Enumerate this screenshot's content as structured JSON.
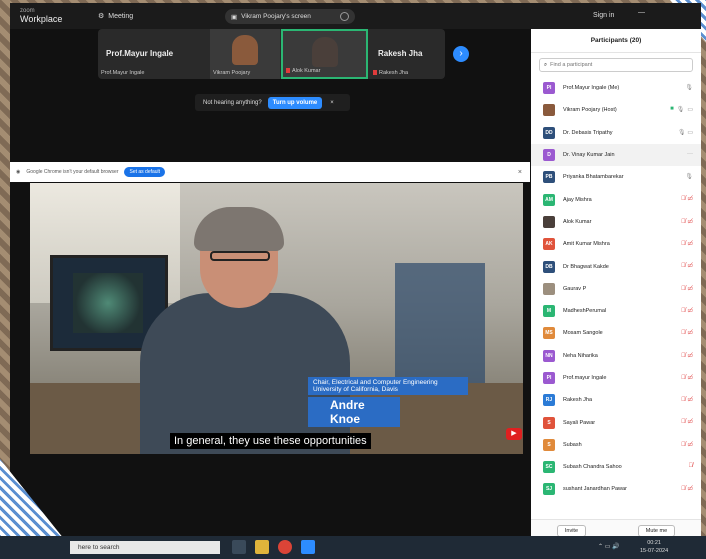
{
  "topbar": {
    "brand_small": "zoom",
    "brand_big": "Workplace",
    "meeting_label": "Meeting",
    "screen_share_label": "Vikram Poojary's screen",
    "signin_label": "Sign in"
  },
  "strip": {
    "tiles": [
      {
        "big": "Prof.Mayur Ingale",
        "small": "Prof.Mayur Ingale"
      },
      {
        "small": "Vikram Poojary"
      },
      {
        "small": "Alok Kumar"
      },
      {
        "big": "Rakesh Jha",
        "small": "Rakesh Jha"
      }
    ]
  },
  "audio_banner": {
    "text": "Not hearing anything?",
    "button": "Turn up volume",
    "close": "×"
  },
  "chrome_bar": {
    "message": "Google Chrome isn't your default browser",
    "button": "Set as default",
    "close": "×"
  },
  "video": {
    "role_line1": "Chair, Electrical and Computer Engineering",
    "role_line2": "University of California, Davis",
    "name": "Andre Knoe",
    "caption": "In general, they use these opportunities"
  },
  "participants": {
    "title": "Participants (20)",
    "search_placeholder": "Find a participant",
    "list": [
      {
        "initials": "PI",
        "color": "#9b59d0",
        "name": "Prof.Mayur Ingale (Me)",
        "status": "mic-grey"
      },
      {
        "initials": "",
        "color": "#8a5a3c",
        "name": "Vikram Poojary (Host)",
        "status": "host"
      },
      {
        "initials": "DD",
        "color": "#2e4f7a",
        "name": "Dr. Debasis Tripathy",
        "status": "mic-video-grey"
      },
      {
        "initials": "D",
        "color": "#9b59d0",
        "name": "Dr. Vinay Kumar Jain",
        "status": "more"
      },
      {
        "initials": "PB",
        "color": "#2e4f7a",
        "name": "Priyanka Bhatambarekar",
        "status": "mic-grey"
      },
      {
        "initials": "AM",
        "color": "#2bb673",
        "name": "Ajay Mishra",
        "status": "muted"
      },
      {
        "initials": "",
        "color": "#4a3f3a",
        "name": "Alok Kumar",
        "status": "muted"
      },
      {
        "initials": "AK",
        "color": "#e0533b",
        "name": "Amit Kumar Mishra",
        "status": "muted"
      },
      {
        "initials": "DB",
        "color": "#2e4f7a",
        "name": "Dr Bhagwat Kakde",
        "status": "muted"
      },
      {
        "initials": "",
        "color": "#9c8f7e",
        "name": "Gaurav P",
        "status": "muted"
      },
      {
        "initials": "M",
        "color": "#2bb673",
        "name": "MadheshPerumal",
        "status": "muted"
      },
      {
        "initials": "MS",
        "color": "#e08a3b",
        "name": "Mosam Sangole",
        "status": "muted"
      },
      {
        "initials": "NN",
        "color": "#9b59d0",
        "name": "Neha Niharika",
        "status": "muted"
      },
      {
        "initials": "PI",
        "color": "#9b59d0",
        "name": "Prof.mayur Ingale",
        "status": "muted"
      },
      {
        "initials": "RJ",
        "color": "#2b7bd6",
        "name": "Rakesh Jha",
        "status": "muted"
      },
      {
        "initials": "S",
        "color": "#e0533b",
        "name": "Sayali Pawar",
        "status": "muted"
      },
      {
        "initials": "S",
        "color": "#e08a3b",
        "name": "Subash",
        "status": "muted"
      },
      {
        "initials": "SC",
        "color": "#2bb673",
        "name": "Subash Chandra Sahoo",
        "status": "muted-mic"
      },
      {
        "initials": "SJ",
        "color": "#2bb673",
        "name": "sushant Janardhan Pawar",
        "status": "muted"
      }
    ],
    "invite_label": "Invite",
    "mute_me_label": "Mute me"
  },
  "taskbar": {
    "search_text": "here to search",
    "time": "00:21",
    "date": "15-07-2024"
  }
}
